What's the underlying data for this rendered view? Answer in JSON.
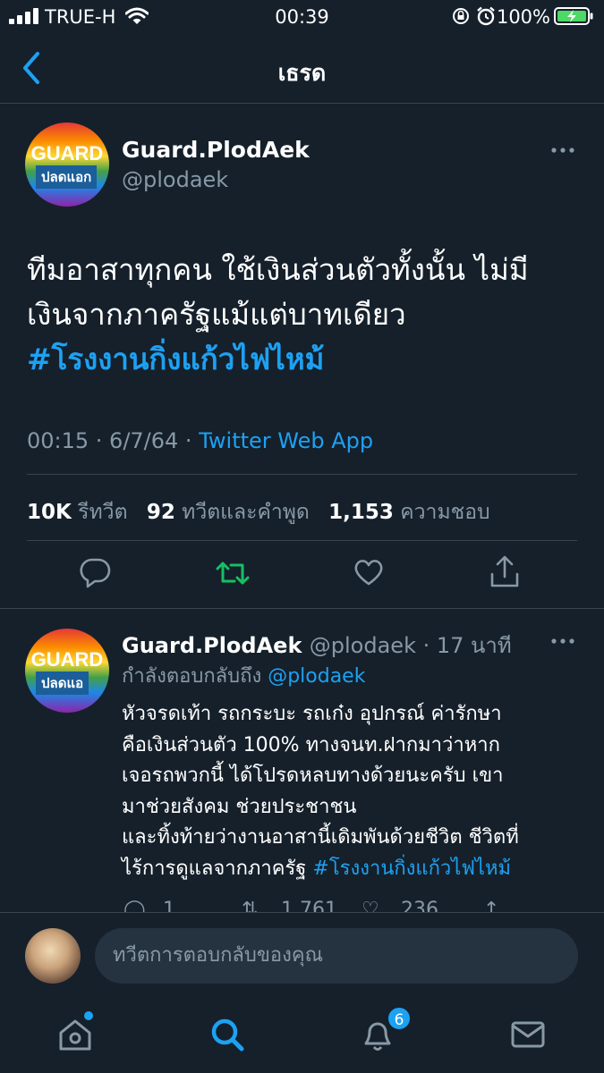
{
  "status_bar": {
    "carrier": "TRUE-H",
    "time": "00:39",
    "battery": "100%",
    "icons": [
      "signal-icon",
      "wifi-icon",
      "lock-rotation-icon",
      "alarm-icon",
      "battery-charging-icon"
    ]
  },
  "header": {
    "title": "เธรด",
    "back_icon": "chevron-left-icon"
  },
  "main_tweet": {
    "avatar_text": "GUARD",
    "avatar_sub": "ปลดแอก",
    "name": "Guard.PlodAek",
    "handle": "@plodaek",
    "text_line1": "ทีมอาสาทุกคน ใช้เงินส่วนตัวทั้งนั้น ไม่มี",
    "text_line2": "เงินจากภาครัฐแม้แต่บาทเดียว",
    "hashtag": "#โรงงานกิ่งแก้วไฟไหม้",
    "time": "00:15 · 6/7/64 ·",
    "source": "Twitter Web App",
    "retweets_count": "10K",
    "retweets_label": "รีทวีต",
    "quotes_count": "92",
    "quotes_label": "ทวีตและคำพูด",
    "likes_count": "1,153",
    "likes_label": "ความชอบ"
  },
  "reply_tweet": {
    "avatar_text": "GUARD",
    "avatar_sub": "ปลดแอ",
    "name": "Guard.PlodAek",
    "handle_time": "@plodaek · 17 นาที",
    "replying_label": "กำลังตอบกลับถึง",
    "replying_to": "@plodaek",
    "text_lines": [
      "หัวจรดเท้า รถกระบะ รถเก๋ง อุปกรณ์ ค่ารักษา",
      "คือเงินส่วนตัว 100% ทางจนท.ฝากมาว่าหาก",
      "เจอรถพวกนี้ ได้โปรดหลบทางด้วยนะครับ เขา",
      "มาช่วยสังคม ช่วยประชาชน",
      "และทิ้งท้ายว่างานอาสานี้เดิมพันด้วยชีวิต ชีวิตที่"
    ],
    "text_last": "ไร้การดูแลจากภาครัฐ",
    "hashtag": "#โรงงานกิ่งแก้วไฟไหม้",
    "reply_count": "1",
    "retweet_count": "1,761",
    "like_count": "236"
  },
  "compose": {
    "placeholder": "ทวีตการตอบกลับของคุณ"
  },
  "tab_bar": {
    "tabs": [
      "home-tab",
      "search-tab",
      "notifications-tab",
      "messages-tab"
    ],
    "notifications_badge": "6",
    "accent": "#1da1f2"
  },
  "colors": {
    "background": "#15202b",
    "accent": "#1da1f2",
    "muted": "#8899a6",
    "retweet_active": "#17bf63"
  }
}
